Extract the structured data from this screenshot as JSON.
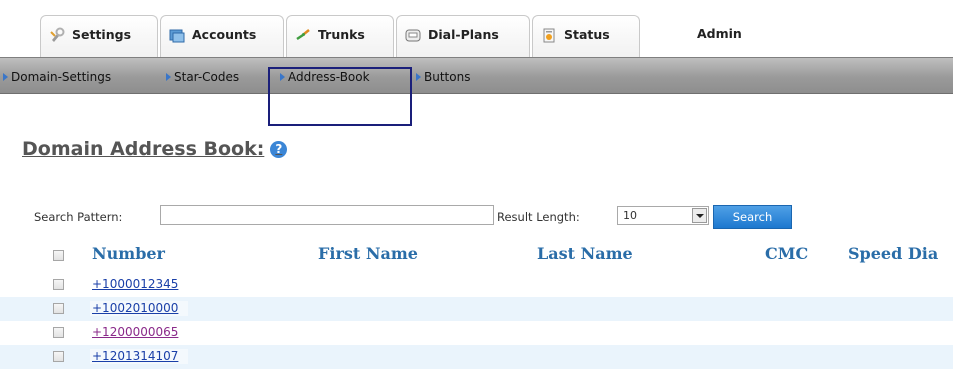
{
  "tabs": [
    {
      "label": "Settings",
      "icon": "settings-icon"
    },
    {
      "label": "Accounts",
      "icon": "accounts-icon"
    },
    {
      "label": "Trunks",
      "icon": "trunks-icon"
    },
    {
      "label": "Dial-Plans",
      "icon": "dial-plans-icon"
    },
    {
      "label": "Status",
      "icon": "status-icon"
    }
  ],
  "admin_label": "Admin",
  "subnav": {
    "items": [
      "Domain-Settings",
      "Star-Codes",
      "Address-Book",
      "Buttons"
    ],
    "highlighted": "Address-Book"
  },
  "page": {
    "title": "Domain Address Book:",
    "help_icon": "?"
  },
  "search": {
    "pattern_label": "Search Pattern:",
    "pattern_value": "",
    "result_length_label": "Result Length:",
    "result_length_value": "10",
    "button_label": "Search"
  },
  "table": {
    "columns": [
      "Number",
      "First Name",
      "Last Name",
      "CMC",
      "Speed Dia"
    ],
    "rows": [
      {
        "number": "+1000012345",
        "visited": false
      },
      {
        "number": "+1002010000",
        "visited": false
      },
      {
        "number": "+1200000065",
        "visited": true
      },
      {
        "number": "+1201314107",
        "visited": false
      }
    ]
  },
  "colors": {
    "accent": "#2a6da8",
    "link": "#1a3fa8",
    "visited_link": "#8a2a8a",
    "highlight_border": "#1a1f7a",
    "button": "#1d78cf"
  }
}
